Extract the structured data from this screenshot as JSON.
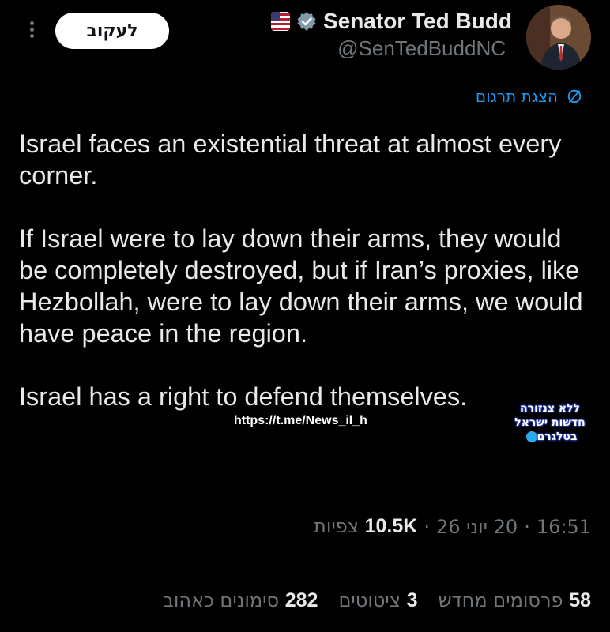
{
  "header": {
    "follow_label": "לעקוב",
    "display_name": "Senator Ted Budd",
    "handle": "@SenTedBuddNC"
  },
  "translate_label": "הצגת תרגום",
  "tweet": {
    "paragraphs": [
      "Israel faces an existential threat at almost every corner.",
      "If Israel were to lay down their arms, they would be completely destroyed, but if Iran’s proxies, like Hezbollah, were to lay down their arms, we would have peace in the region.",
      "Israel has a right to defend themselves."
    ]
  },
  "overlay": {
    "link": "https://t.me/News_il_h",
    "watermark_line1": "ללא צנזורה",
    "watermark_line2": "חדשות ישראל",
    "watermark_line3": "בטלגרם"
  },
  "meta": {
    "time": "16:51",
    "date": "20 יוני 26",
    "views_count": "10.5K",
    "views_label": "צפיות"
  },
  "stats": {
    "reposts_count": "58",
    "reposts_label": "פרסומים מחדש",
    "quotes_count": "3",
    "quotes_label": "ציטוטים",
    "likes_count": "282",
    "likes_label": "סימונים כאהוב"
  },
  "colors": {
    "accent": "#1d9bf0",
    "muted": "#71767b",
    "background": "#000000"
  }
}
